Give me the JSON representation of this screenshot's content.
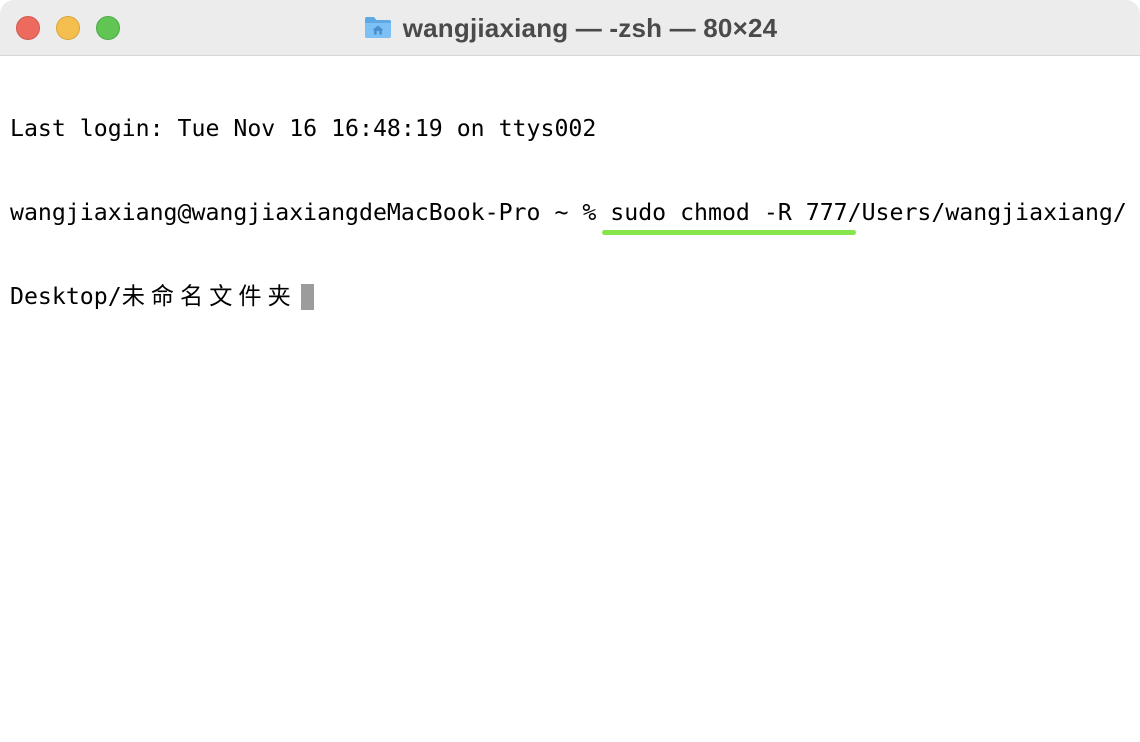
{
  "window": {
    "title": "wangjiaxiang — -zsh — 80×24",
    "title_icon": "home-folder-icon",
    "colors": {
      "close": "#ec6a5e",
      "minimize": "#f4bf4f",
      "zoom": "#61c554",
      "highlight_underline": "#86e54a"
    }
  },
  "terminal": {
    "login_line": "Last login: Tue Nov 16 16:48:19 on ttys002",
    "prompt": "wangjiaxiang@wangjiaxiangdeMacBook-Pro ~ % ",
    "command_highlighted": "sudo chmod -R 777",
    "command_rest": "/Users/wangjiaxiang/",
    "path_prefix": "Desktop/",
    "path_folder": "未命名文件夹"
  }
}
